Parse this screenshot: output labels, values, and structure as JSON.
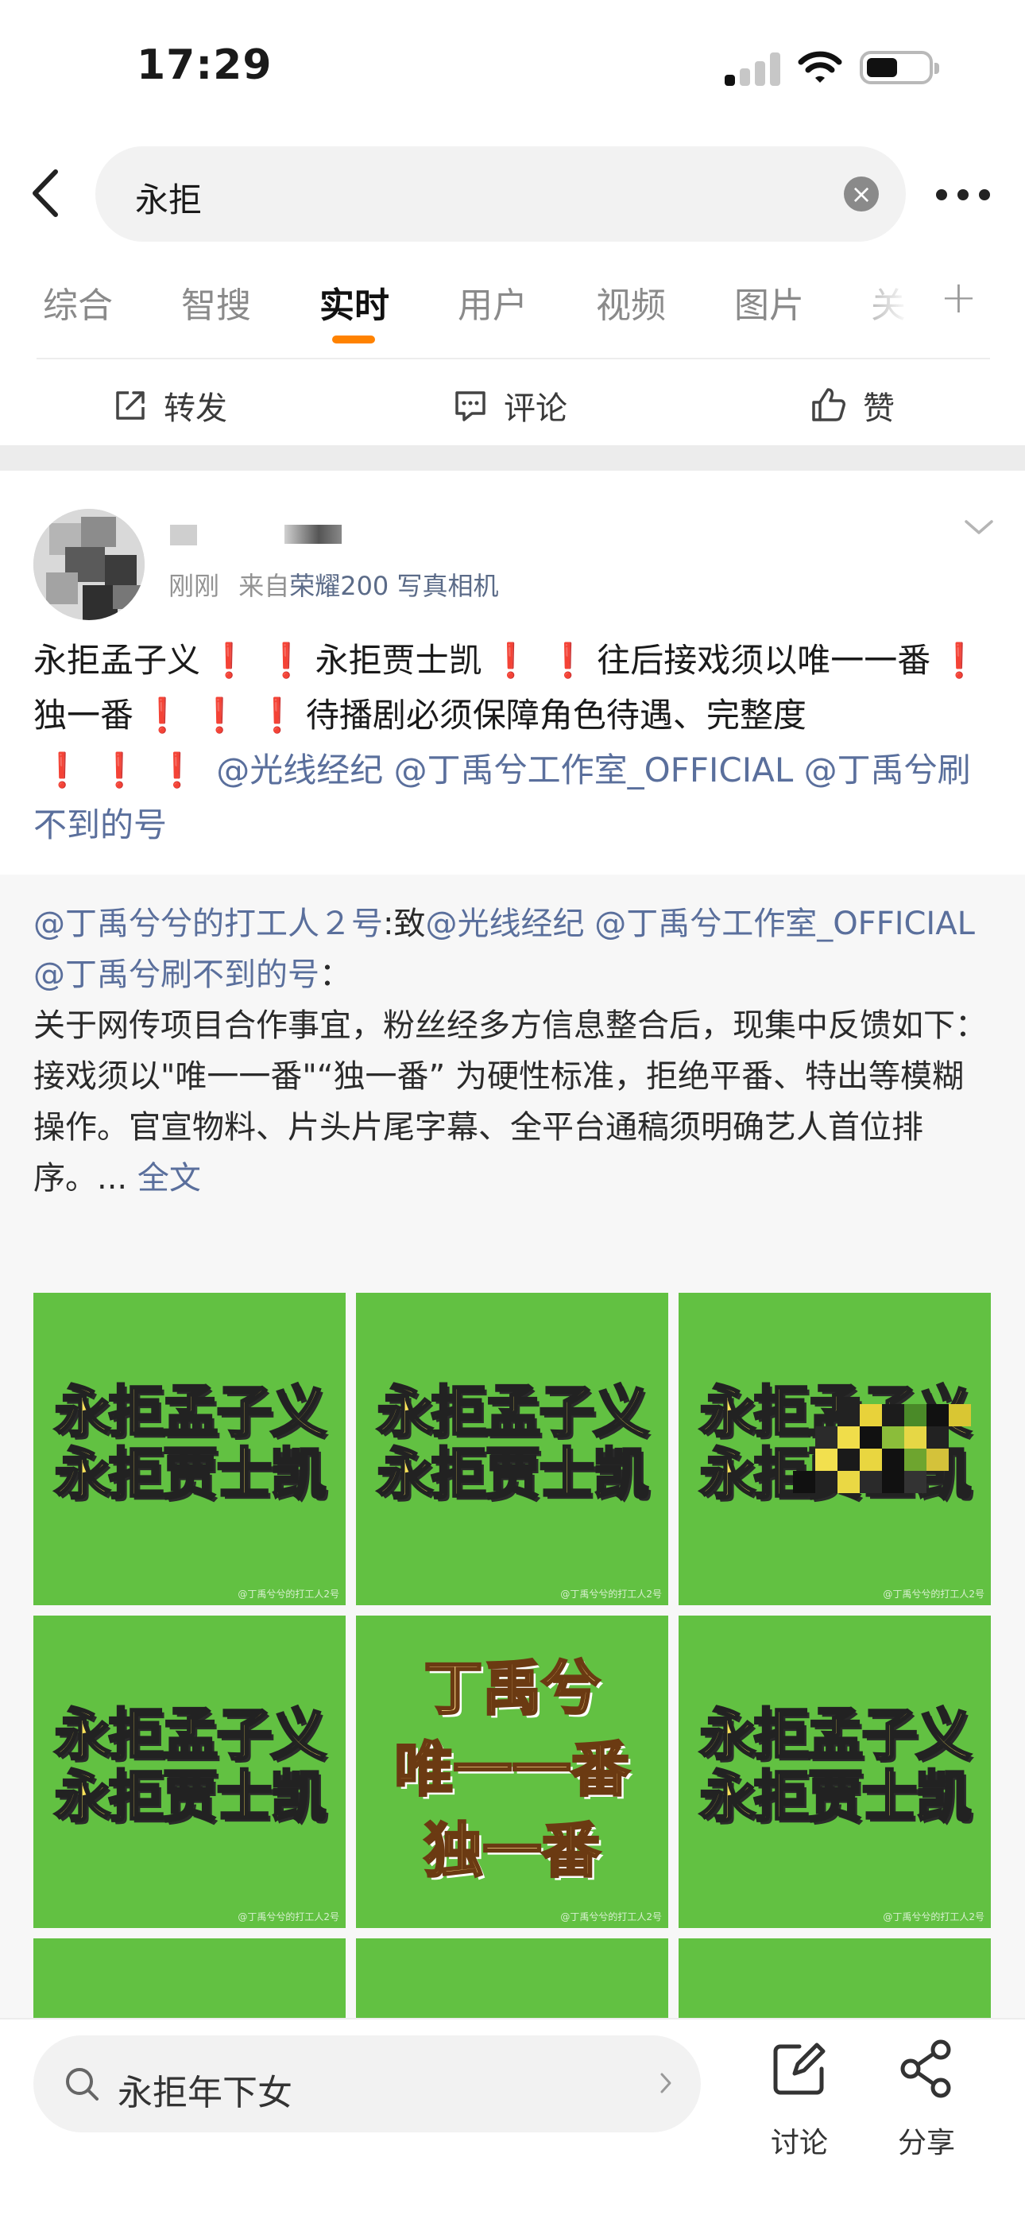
{
  "status": {
    "time": "17:29"
  },
  "search": {
    "query": "永拒",
    "clear_symbol": "×"
  },
  "tabs": [
    {
      "label": "综合"
    },
    {
      "label": "智搜"
    },
    {
      "label": "实时"
    },
    {
      "label": "用户"
    },
    {
      "label": "视频"
    },
    {
      "label": "图片"
    },
    {
      "label": "关"
    }
  ],
  "tab_add_symbol": "+",
  "actions": {
    "forward": "转发",
    "comment": "评论",
    "like": "赞"
  },
  "post": {
    "meta_time": "刚刚",
    "meta_from": "来自",
    "meta_device": "荣耀200 写真相机",
    "text": {
      "p1": "永拒孟子义",
      "p2": "永拒贾士凯",
      "p3": "往后接戏须以唯一一番",
      "p4": "独一番",
      "p5": "待播剧必须保障角色待遇、完整度",
      "m1": "@光线经纪",
      "m2": "@丁禹兮工作室_OFFICIAL",
      "m3": "@丁禹兮刷不到的号"
    },
    "exclamation": "❗"
  },
  "repost": {
    "author": "@丁禹兮兮的打工人２号",
    "to": ":致",
    "m1": "@光线经纪",
    "m2": "@丁禹兮工作室_OFFICIAL",
    "m3": "@丁禹兮刷不到的号",
    "colon": "：",
    "line1": "关于网传项目合作事宜，粉丝经多方信息整合后，现集中反馈如下：",
    "line2": "接戏须以\"唯一一番\"“独一番” 为硬性标准，拒绝平番、特出等模糊操作。官宣物料、片头片尾字幕、全平台通稿须明确艺人首位排序。...",
    "fulltext": "全文"
  },
  "images": {
    "caption_l1": "永拒孟子义",
    "caption_l2": "永拒贾士凯",
    "center_l1": "丁禹兮",
    "center_l2": "唯一一番",
    "center_l3": "独一番",
    "watermark": "@丁禹兮兮的打工人2号",
    "green": "#62c142"
  },
  "bottom": {
    "hot_search": "永拒年下女",
    "discuss": "讨论",
    "share": "分享"
  },
  "colors": {
    "accent": "#ff8200",
    "link": "#5a6f9c",
    "exclamation": "#e02020"
  }
}
